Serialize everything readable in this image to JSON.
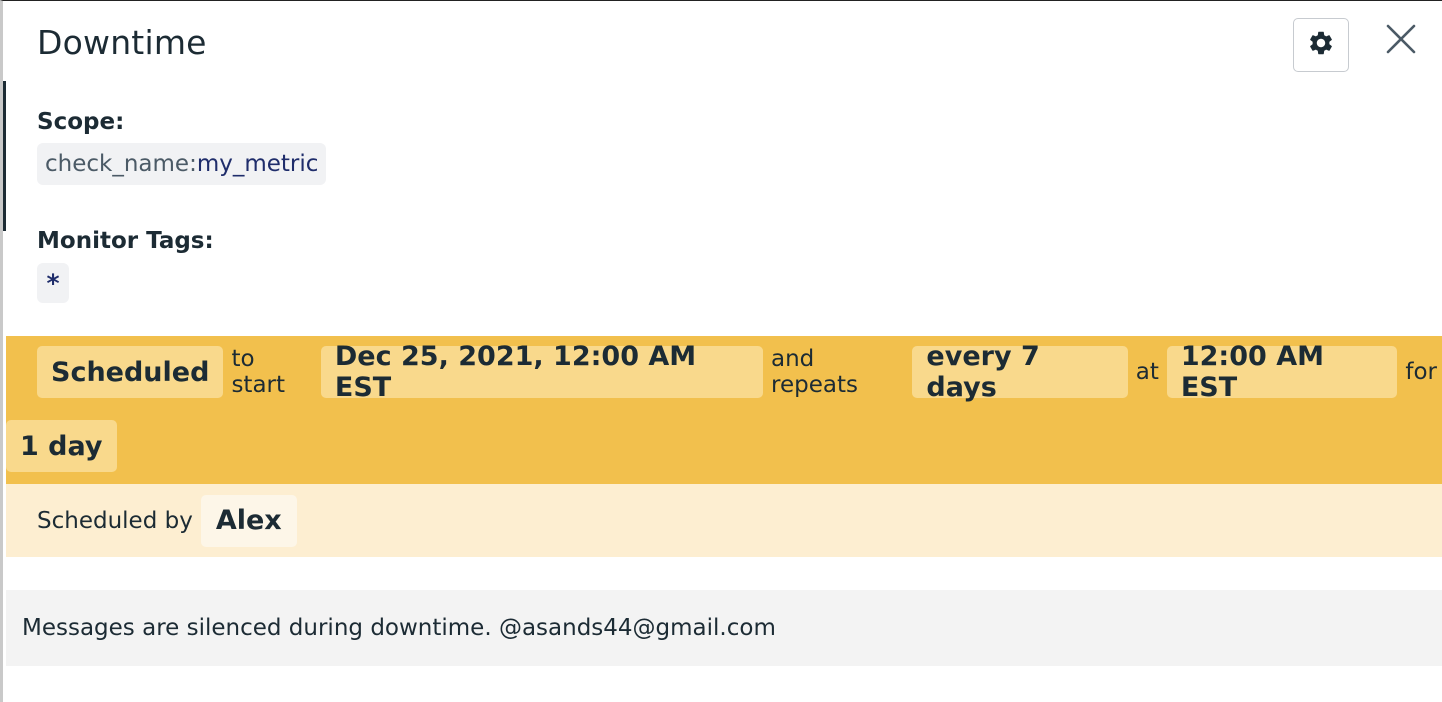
{
  "header": {
    "title": "Downtime",
    "settings_icon": "gear-icon",
    "close_icon": "close-icon"
  },
  "scope": {
    "label": "Scope:",
    "key": "check_name:",
    "value": "my_metric"
  },
  "monitor_tags": {
    "label": "Monitor Tags:",
    "tag": "*"
  },
  "schedule": {
    "status": "Scheduled",
    "to_start_text": "to start",
    "start": "Dec 25, 2021, 12:00 AM EST",
    "repeats_text": "and repeats",
    "interval": "every 7 days",
    "at_text": "at",
    "time": "12:00 AM EST",
    "for_text": "for",
    "duration": "1 day"
  },
  "scheduled_by": {
    "text": "Scheduled by",
    "user": "Alex"
  },
  "message": "Messages are silenced during downtime. @asands44@gmail.com",
  "colors": {
    "schedule_bg": "#f2c04d",
    "schedule_chip": "#f9d98c",
    "byline_bg": "#fdeed1",
    "message_bg": "#f3f3f3",
    "text": "#1c2b34",
    "tag_value": "#1f2d6b"
  }
}
